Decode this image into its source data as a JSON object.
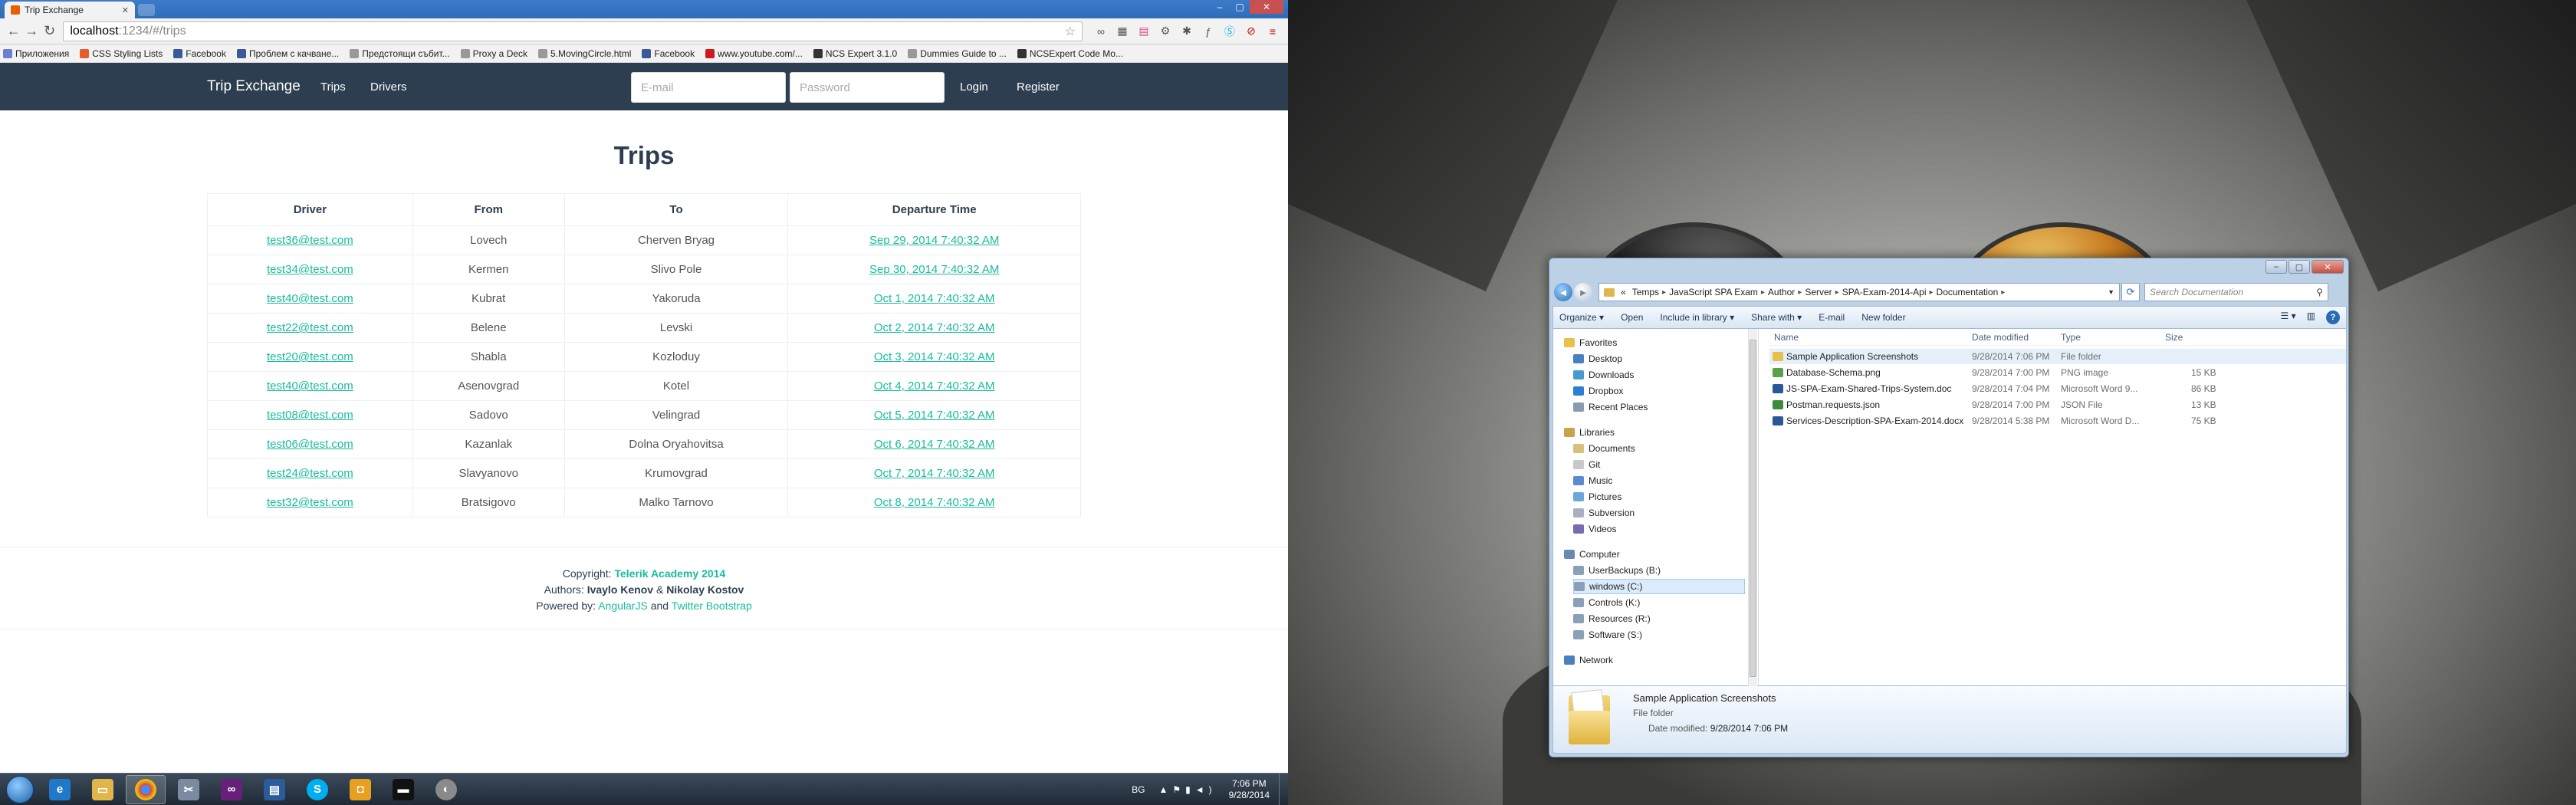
{
  "browser": {
    "tab_title": "Trip Exchange",
    "url_host": "localhost",
    "url_path": ":1234/#/trips",
    "bookmarks": [
      {
        "label": "Приложения",
        "color": "#6d7fd1"
      },
      {
        "label": "CSS Styling Lists",
        "color": "#e65c2c"
      },
      {
        "label": "Facebook",
        "color": "#3b5998"
      },
      {
        "label": "Проблем с качване...",
        "color": "#3b5998"
      },
      {
        "label": "Предстоящи събит...",
        "color": "#999999"
      },
      {
        "label": "Proxy a Deck",
        "color": "#999999"
      },
      {
        "label": "5.MovingCircle.html",
        "color": "#999999"
      },
      {
        "label": "Facebook",
        "color": "#3b5998"
      },
      {
        "label": "www.youtube.com/...",
        "color": "#cc181e"
      },
      {
        "label": "NCS Expert 3.1.0",
        "color": "#333333"
      },
      {
        "label": "Dummies Guide to ...",
        "color": "#999999"
      },
      {
        "label": "NCSExpert Code Mo...",
        "color": "#333333"
      }
    ]
  },
  "app": {
    "brand": "Trip Exchange",
    "nav_trips": "Trips",
    "nav_drivers": "Drivers",
    "email_placeholder": "E-mail",
    "password_placeholder": "Password",
    "login": "Login",
    "register": "Register",
    "page_title": "Trips",
    "columns": [
      "Driver",
      "From",
      "To",
      "Departure Time"
    ],
    "rows": [
      {
        "driver": "test36@test.com",
        "from": "Lovech",
        "to": "Cherven Bryag",
        "time": "Sep 29, 2014 7:40:32 AM"
      },
      {
        "driver": "test34@test.com",
        "from": "Kermen",
        "to": "Slivo Pole",
        "time": "Sep 30, 2014 7:40:32 AM"
      },
      {
        "driver": "test40@test.com",
        "from": "Kubrat",
        "to": "Yakoruda",
        "time": "Oct 1, 2014 7:40:32 AM"
      },
      {
        "driver": "test22@test.com",
        "from": "Belene",
        "to": "Levski",
        "time": "Oct 2, 2014 7:40:32 AM"
      },
      {
        "driver": "test20@test.com",
        "from": "Shabla",
        "to": "Kozloduy",
        "time": "Oct 3, 2014 7:40:32 AM"
      },
      {
        "driver": "test40@test.com",
        "from": "Asenovgrad",
        "to": "Kotel",
        "time": "Oct 4, 2014 7:40:32 AM"
      },
      {
        "driver": "test08@test.com",
        "from": "Sadovo",
        "to": "Velingrad",
        "time": "Oct 5, 2014 7:40:32 AM"
      },
      {
        "driver": "test06@test.com",
        "from": "Kazanlak",
        "to": "Dolna Oryahovitsa",
        "time": "Oct 6, 2014 7:40:32 AM"
      },
      {
        "driver": "test24@test.com",
        "from": "Slavyanovo",
        "to": "Krumovgrad",
        "time": "Oct 7, 2014 7:40:32 AM"
      },
      {
        "driver": "test32@test.com",
        "from": "Bratsigovo",
        "to": "Malko Tarnovo",
        "time": "Oct 8, 2014 7:40:32 AM"
      }
    ],
    "footer": {
      "copyright_label": "Copyright:",
      "copyright_org": "Telerik Academy 2014",
      "authors_label": "Authors:",
      "author1": "Ivaylo Kenov",
      "and_sep": "&",
      "author2": "Nikolay Kostov",
      "powered_label": "Powered by:",
      "tech1": "AngularJS",
      "and_word": "and",
      "tech2": "Twitter Bootstrap"
    }
  },
  "taskbar": {
    "lang": "BG",
    "time": "7:06 PM",
    "date": "9/28/2014"
  },
  "explorer": {
    "breadcrumbs": [
      "«",
      "Temps",
      "JavaScript SPA Exam",
      "Author",
      "Server",
      "SPA-Exam-2014-Api",
      "Documentation"
    ],
    "search_placeholder": "Search Documentation",
    "commands": [
      "Organize ▾",
      "Open",
      "Include in library ▾",
      "Share with ▾",
      "E-mail",
      "New folder"
    ],
    "nav": {
      "favorites": "Favorites",
      "fav_items": [
        "Desktop",
        "Downloads",
        "Dropbox",
        "Recent Places"
      ],
      "libraries": "Libraries",
      "lib_items": [
        "Documents",
        "Git",
        "Music",
        "Pictures",
        "Subversion",
        "Videos"
      ],
      "computer": "Computer",
      "drives": [
        "UserBackups (B:)",
        "windows (C:)",
        "Controls (K:)",
        "Resources (R:)",
        "Software (S:)"
      ],
      "network": "Network"
    },
    "columns": [
      "Name",
      "Date modified",
      "Type",
      "Size"
    ],
    "files": [
      {
        "name": "Sample Application Screenshots",
        "date": "9/28/2014 7:06 PM",
        "type": "File folder",
        "size": "",
        "icon_color": "#e8c04a"
      },
      {
        "name": "Database-Schema.png",
        "date": "9/28/2014 7:00 PM",
        "type": "PNG image",
        "size": "15 KB",
        "icon_color": "#5aa04a"
      },
      {
        "name": "JS-SPA-Exam-Shared-Trips-System.doc",
        "date": "9/28/2014 7:04 PM",
        "type": "Microsoft Word 9...",
        "size": "86 KB",
        "icon_color": "#2b5797"
      },
      {
        "name": "Postman.requests.json",
        "date": "9/28/2014 7:00 PM",
        "type": "JSON File",
        "size": "13 KB",
        "icon_color": "#3d8a3d"
      },
      {
        "name": "Services-Description-SPA-Exam-2014.docx",
        "date": "9/28/2014 5:38 PM",
        "type": "Microsoft Word D...",
        "size": "75 KB",
        "icon_color": "#2b5797"
      }
    ],
    "details": {
      "name": "Sample Application Screenshots",
      "type": "File folder",
      "date_label": "Date modified:",
      "date_value": "9/28/2014 7:06 PM"
    }
  }
}
